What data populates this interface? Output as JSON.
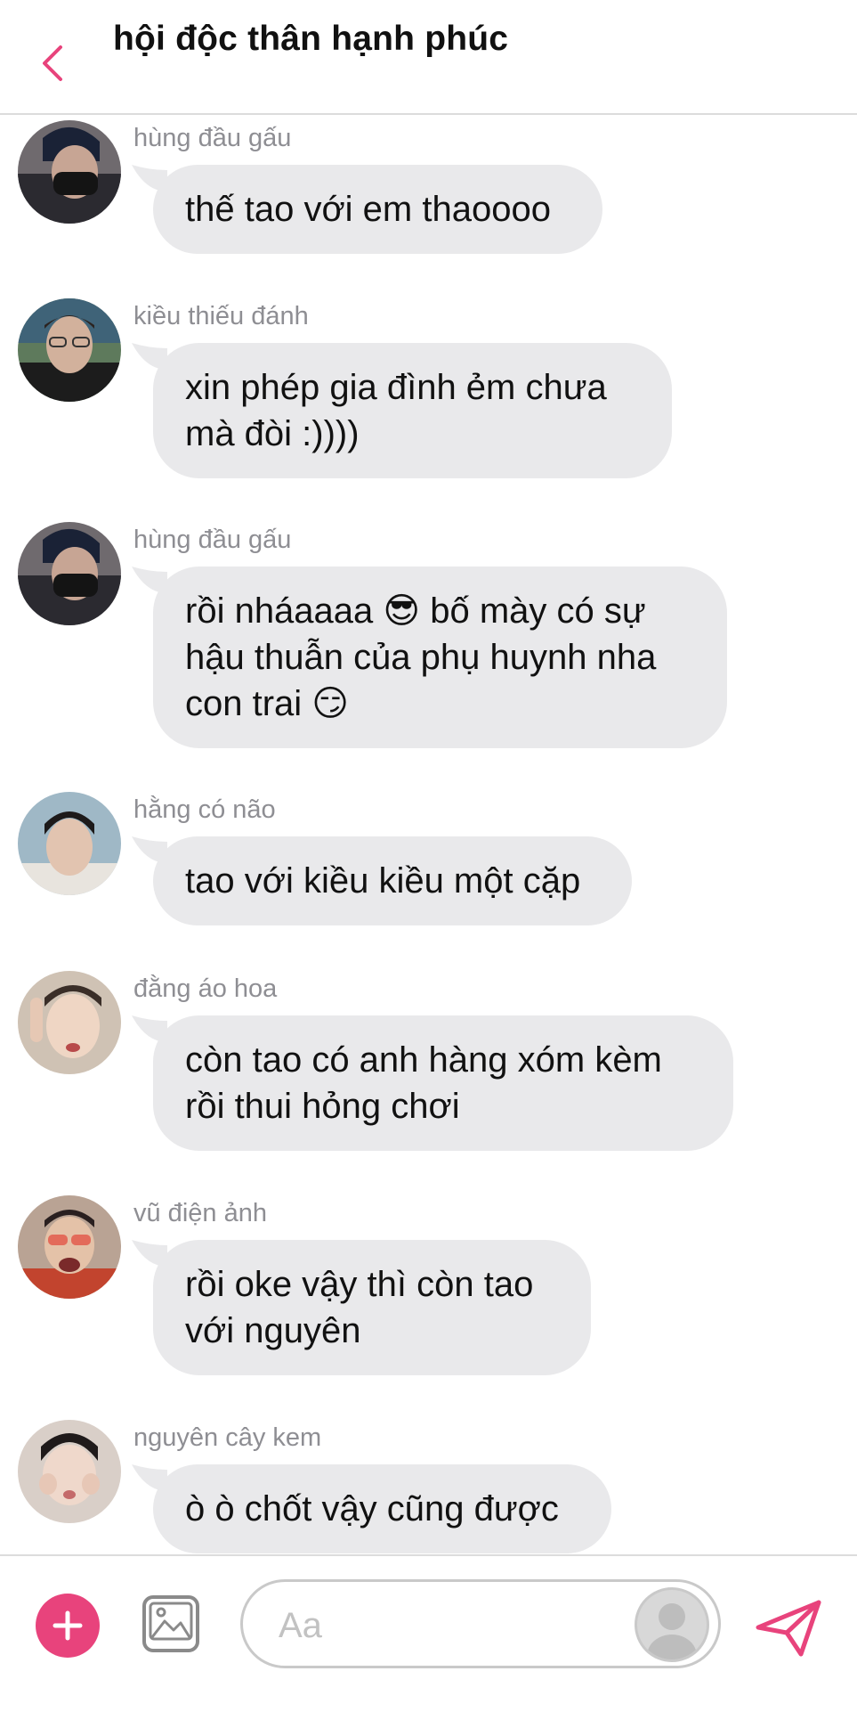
{
  "header": {
    "title": "hội độc thân hạnh phúc"
  },
  "messages": [
    {
      "sender": "hùng đầu gấu",
      "text": "thế tao với em thaoooo"
    },
    {
      "sender": "kiều thiếu đánh",
      "text": "xin phép gia đình ẻm chưa mà đòi :))))"
    },
    {
      "sender": "hùng đầu gấu",
      "text": "rồi nháaaaa 😎 bố mày có sự hậu thuẫn của phụ huynh nha con trai 😏"
    },
    {
      "sender": "hằng có não",
      "text": "tao với kiều kiều một cặp"
    },
    {
      "sender": "đằng áo hoa",
      "text": "còn tao có anh hàng xóm kèm rồi thui hỏng chơi"
    },
    {
      "sender": "vũ điện ảnh",
      "text": "rồi oke vậy thì còn tao với nguyên"
    },
    {
      "sender": "nguyên cây kem",
      "text": "ò ò chốt vậy cũng được"
    }
  ],
  "composer": {
    "placeholder": "Aa"
  },
  "colors": {
    "accent": "#e8437c",
    "bubble": "#e9e9eb",
    "sender": "#8e8e93"
  },
  "icons": {
    "back": "chevron-left-icon",
    "plus": "plus-icon",
    "image": "image-icon",
    "send": "send-icon"
  }
}
